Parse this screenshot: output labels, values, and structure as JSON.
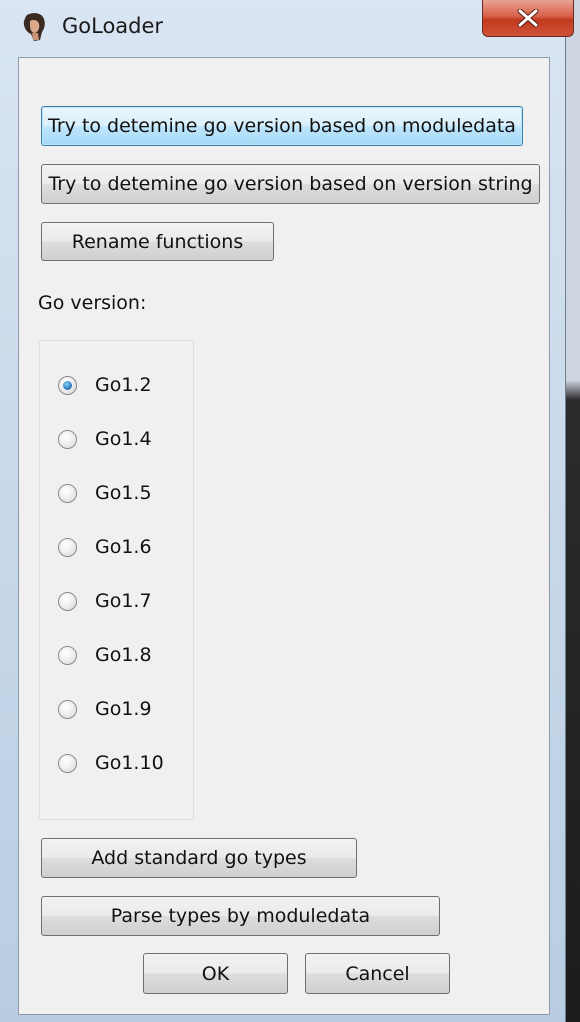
{
  "window": {
    "title": "GoLoader"
  },
  "buttons": {
    "moduledata_version": "Try to detemine go version based on moduledata",
    "version_string": "Try to detemine go version based on version string",
    "rename_functions": "Rename functions",
    "add_standard_types": "Add standard go types",
    "parse_types": "Parse types by moduledata",
    "ok": "OK",
    "cancel": "Cancel"
  },
  "go_version": {
    "label": "Go version:",
    "selected": "Go1.2",
    "options": [
      "Go1.2",
      "Go1.4",
      "Go1.5",
      "Go1.6",
      "Go1.7",
      "Go1.8",
      "Go1.9",
      "Go1.10"
    ]
  },
  "icons": {
    "app": "goloader-app-icon",
    "close": "close-icon"
  },
  "colors": {
    "close_button": "#c7432a",
    "focus_border": "#3c7fb1",
    "dialog_bg": "#f0f0f0",
    "radio_selected": "#2f83c2"
  }
}
